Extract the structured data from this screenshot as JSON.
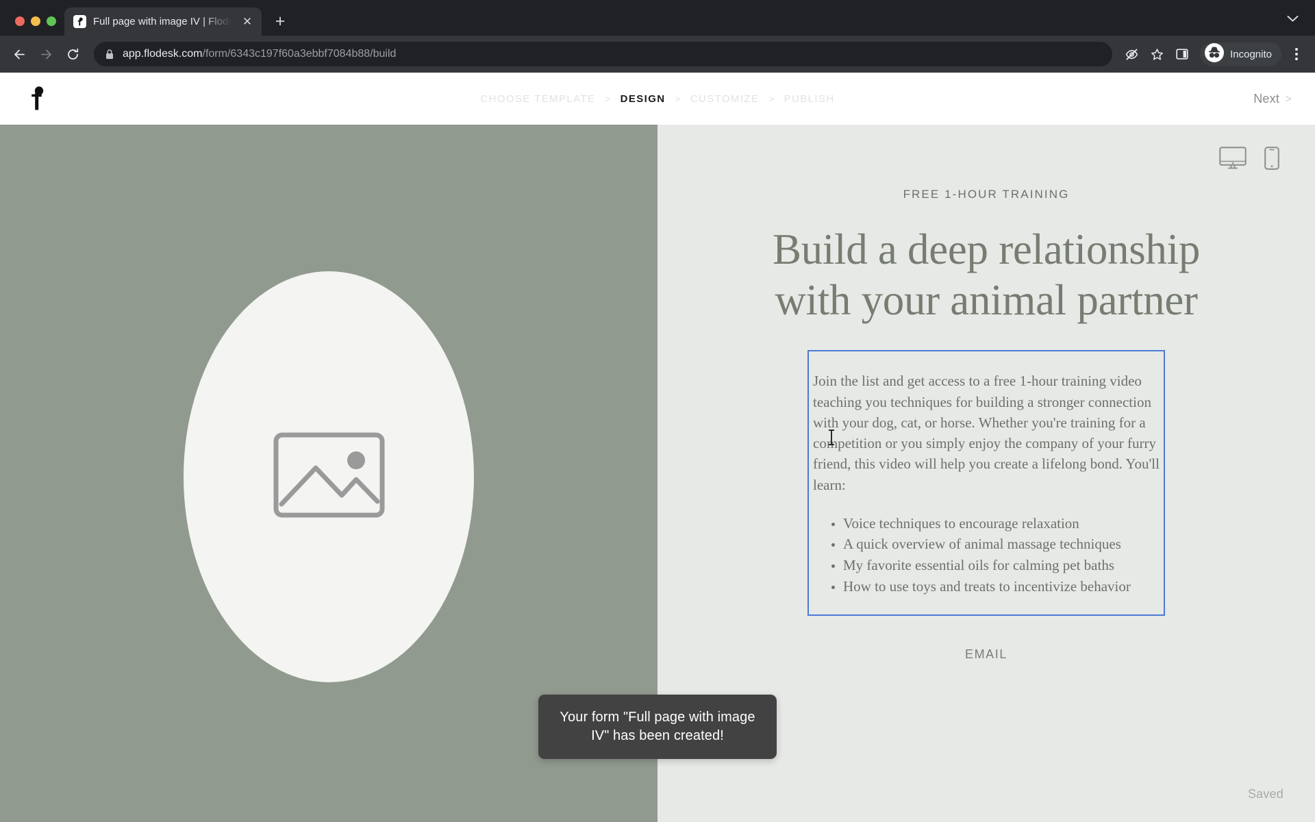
{
  "browser": {
    "tab": {
      "title": "Full page with image IV | Flodesk",
      "favicon_icon": "flodesk-f-icon",
      "close_icon": "close-icon"
    },
    "new_tab_icon": "plus-icon",
    "tab_list_icon": "chevron-down-icon",
    "back_icon": "back-arrow-icon",
    "forward_icon": "forward-arrow-icon",
    "reload_icon": "reload-icon",
    "lock_icon": "lock-icon",
    "url_host": "app.flodesk.com",
    "url_path": "/form/6343c197f60a3ebbf7084b88/build",
    "third_party_cookies_icon": "eye-slash-icon",
    "bookmark_icon": "star-icon",
    "side_panel_icon": "side-panel-icon",
    "profile": {
      "icon": "incognito-icon",
      "label": "Incognito"
    },
    "menu_icon": "kebab-menu-icon"
  },
  "app": {
    "logo_icon": "flodesk-logo-icon",
    "steps": [
      {
        "label": "CHOOSE TEMPLATE",
        "active": false
      },
      {
        "label": "DESIGN",
        "active": true
      },
      {
        "label": "CUSTOMIZE",
        "active": false
      },
      {
        "label": "PUBLISH",
        "active": false
      }
    ],
    "step_separator": ">",
    "next_label": "Next",
    "next_arrow": ">",
    "save_status": "Saved"
  },
  "preview": {
    "device_toggle": {
      "desktop_icon": "desktop-monitor-icon",
      "mobile_icon": "mobile-phone-icon"
    },
    "left_panel": {
      "background_color": "#919a8e",
      "shape_color": "#f4f4f2",
      "image_placeholder_icon": "image-placeholder-icon"
    },
    "right_panel": {
      "background_color": "#e7e9e6",
      "eyebrow": "FREE 1-HOUR TRAINING",
      "headline": "Build a deep relationship with your animal partner",
      "body_paragraph": "Join the list and get access to a free 1-hour training video teaching you techniques for building a stronger connection with your dog, cat, or horse. Whether you're training for a competition or you simply enjoy the company of your furry friend, this video will help you create a lifelong bond. You'll learn:",
      "bullets": [
        "Voice techniques to encourage relaxation",
        "A quick overview of animal massage techniques",
        "My favorite essential oils for calming pet baths",
        "How to use toys and treats to incentivize behavior"
      ],
      "email_label": "EMAIL",
      "selection_color": "#4b79d4"
    }
  },
  "toast": {
    "message": "Your form \"Full page with image IV\" has been created!",
    "background_color": "#424242"
  }
}
